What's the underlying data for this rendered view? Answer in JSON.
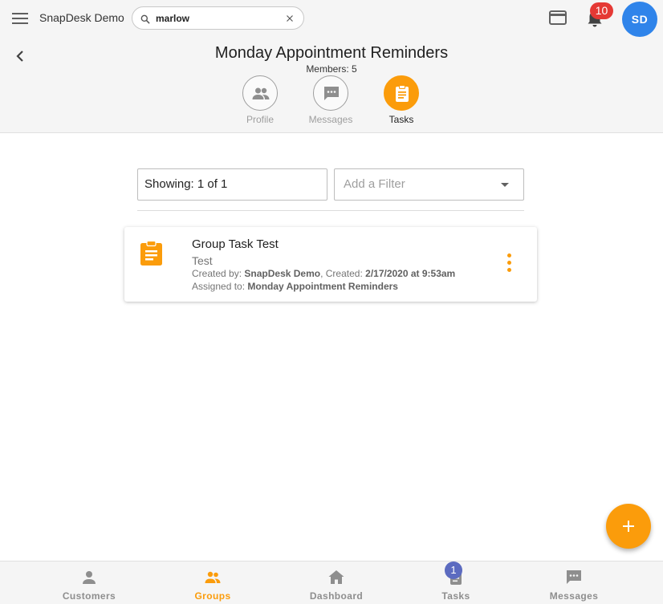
{
  "header": {
    "app_title": "SnapDesk Demo",
    "search": {
      "value": "marlow",
      "placeholder": ""
    },
    "notification_count": "10",
    "avatar_initials": "SD"
  },
  "group": {
    "title": "Monday Appointment Reminders",
    "members": "Members: 5",
    "tabs": [
      {
        "label": "Profile",
        "icon": "people-icon",
        "active": false
      },
      {
        "label": "Messages",
        "icon": "message-icon",
        "active": false
      },
      {
        "label": "Tasks",
        "icon": "clipboard-icon",
        "active": true
      }
    ]
  },
  "filters": {
    "showing": "Showing: 1 of 1",
    "add_filter_placeholder": "Add a Filter"
  },
  "tasks": [
    {
      "title": "Group Task Test",
      "description": "Test",
      "created_by_label": "Created by:",
      "created_by": "SnapDesk Demo",
      "created_label": ", Created:",
      "created": "2/17/2020 at 9:53am",
      "assigned_label": "Assigned to:",
      "assigned_to": "Monday Appointment Reminders"
    }
  ],
  "bottom_nav": {
    "items": [
      {
        "label": "Customers",
        "icon": "person-icon",
        "active": false
      },
      {
        "label": "Groups",
        "icon": "groups-icon",
        "active": true
      },
      {
        "label": "Dashboard",
        "icon": "home-icon",
        "active": false
      },
      {
        "label": "Tasks",
        "icon": "clipboard-icon",
        "active": false
      },
      {
        "label": "Messages",
        "icon": "message-icon",
        "active": false
      }
    ],
    "tasks_badge": "1"
  },
  "colors": {
    "accent": "#fb9c0b",
    "avatar": "#2f84ea",
    "notification_badge": "#e53935",
    "nav_badge": "#5c6bc0"
  }
}
